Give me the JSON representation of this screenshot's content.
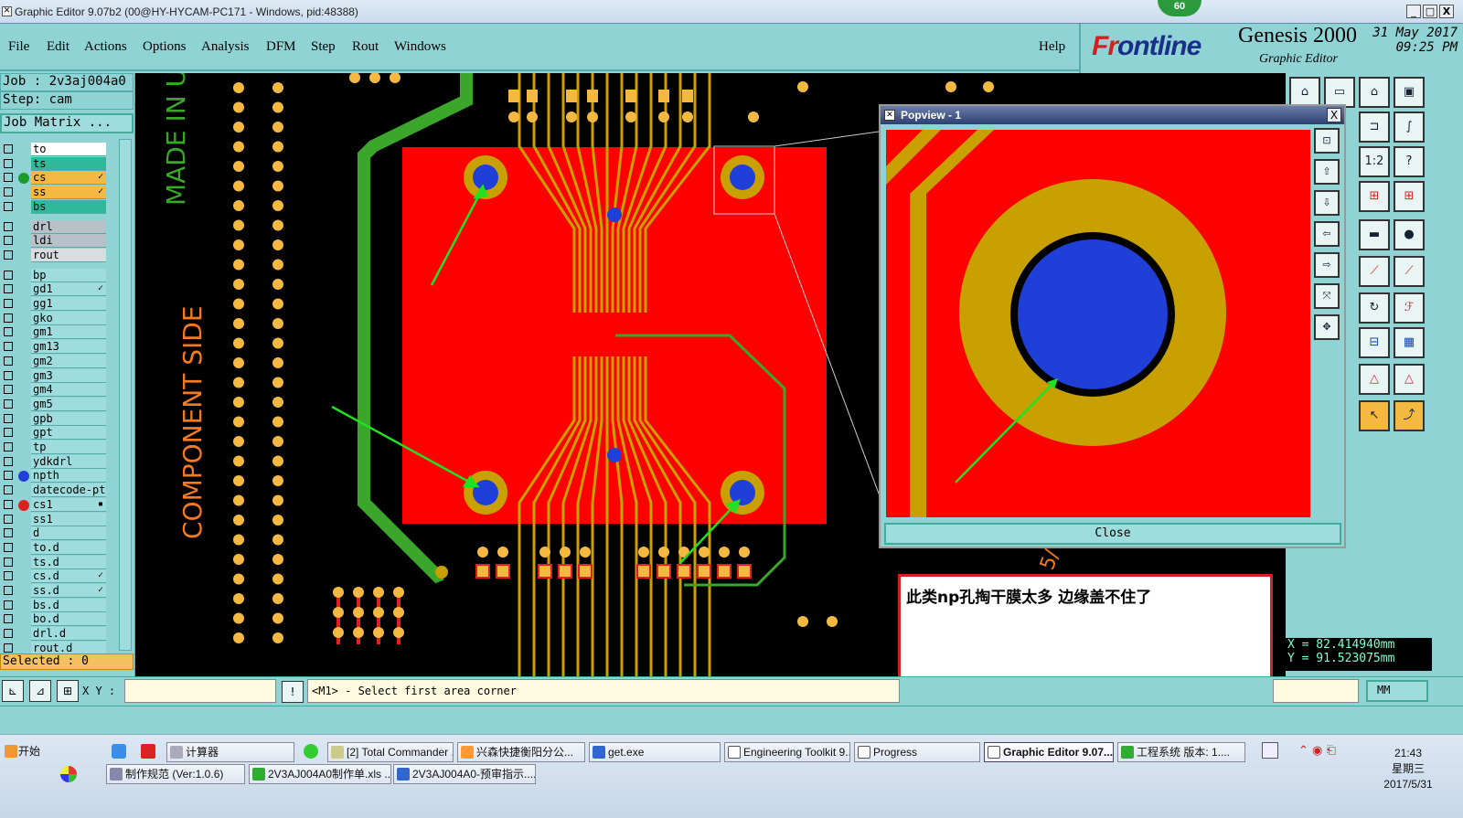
{
  "window": {
    "title": "Graphic Editor 9.07b2 (00@HY-HYCAM-PC171 - Windows, pid:48388)",
    "badge": "60",
    "min": "_",
    "max": "□",
    "close": "X"
  },
  "menu": [
    "File",
    "Edit",
    "Actions",
    "Options",
    "Analysis",
    "DFM",
    "Step",
    "Rout",
    "Windows"
  ],
  "help": "Help",
  "brand": {
    "logo_a": "Fr",
    "logo_b": "ontline",
    "product": "Genesis 2000",
    "subtitle": "Graphic Editor",
    "date": "31 May 2017",
    "time": "09:25 PM"
  },
  "job": {
    "job_line": "Job : 2v3aj004a0",
    "step_line": "Step: cam",
    "matrix": "Job Matrix ..."
  },
  "layers": [
    {
      "name": "to",
      "color": "#ffffff",
      "dot": ""
    },
    {
      "name": "ts",
      "color": "#2fb89a",
      "dot": ""
    },
    {
      "name": "cs",
      "color": "#f5b942",
      "dot": "#1e9a2a",
      "mark": "✓"
    },
    {
      "name": "ss",
      "color": "#f5b942",
      "dot": "",
      "mark": "✓"
    },
    {
      "name": "bs",
      "color": "#2fb89a",
      "dot": ""
    },
    {
      "name": "drl",
      "color": "#b8c0c8",
      "dot": ""
    },
    {
      "name": "ldi",
      "color": "#b8c0c8",
      "dot": ""
    },
    {
      "name": "rout",
      "color": "#d8dde0",
      "dot": ""
    },
    {
      "name": "bp",
      "color": "#9fdcde",
      "dot": ""
    },
    {
      "name": "gd1",
      "color": "#9fdcde",
      "dot": "",
      "mark": "✓"
    },
    {
      "name": "gg1",
      "color": "#9fdcde",
      "dot": ""
    },
    {
      "name": "gko",
      "color": "#9fdcde",
      "dot": ""
    },
    {
      "name": "gm1",
      "color": "#9fdcde",
      "dot": ""
    },
    {
      "name": "gm13",
      "color": "#9fdcde",
      "dot": ""
    },
    {
      "name": "gm2",
      "color": "#9fdcde",
      "dot": ""
    },
    {
      "name": "gm3",
      "color": "#9fdcde",
      "dot": ""
    },
    {
      "name": "gm4",
      "color": "#9fdcde",
      "dot": ""
    },
    {
      "name": "gm5",
      "color": "#9fdcde",
      "dot": ""
    },
    {
      "name": "gpb",
      "color": "#9fdcde",
      "dot": ""
    },
    {
      "name": "gpt",
      "color": "#9fdcde",
      "dot": ""
    },
    {
      "name": "tp",
      "color": "#9fdcde",
      "dot": ""
    },
    {
      "name": "ydkdrl",
      "color": "#9fdcde",
      "dot": ""
    },
    {
      "name": "npth",
      "color": "#9fdcde",
      "dot": "#1f3fd8"
    },
    {
      "name": "datecode-pt",
      "color": "#9fdcde",
      "dot": ""
    },
    {
      "name": "cs1",
      "color": "#9fdcde",
      "dot": "#e02020",
      "mark": "▪"
    },
    {
      "name": "ss1",
      "color": "#9fdcde",
      "dot": ""
    },
    {
      "name": "d",
      "color": "#9fdcde",
      "dot": ""
    },
    {
      "name": "to.d",
      "color": "#9fdcde",
      "dot": ""
    },
    {
      "name": "ts.d",
      "color": "#9fdcde",
      "dot": ""
    },
    {
      "name": "cs.d",
      "color": "#9fdcde",
      "dot": "",
      "mark": "✓"
    },
    {
      "name": "ss.d",
      "color": "#9fdcde",
      "dot": "",
      "mark": "✓"
    },
    {
      "name": "bs.d",
      "color": "#9fdcde",
      "dot": ""
    },
    {
      "name": "bo.d",
      "color": "#9fdcde",
      "dot": ""
    },
    {
      "name": "drl.d",
      "color": "#9fdcde",
      "dot": ""
    },
    {
      "name": "rout.d",
      "color": "#9fdcde",
      "dot": ""
    }
  ],
  "selected": "Selected : 0",
  "silk": {
    "made_in": "MADE IN US",
    "component_side": "COMPONENT SIDE"
  },
  "popview": {
    "title": "Popview - 1",
    "close": "Close",
    "close_x": "X"
  },
  "note": "此类np孔掏干膜太多 边缘盖不住了",
  "coords": {
    "x": "X = 82.414940mm",
    "y": "Y = 91.523075mm"
  },
  "cmd": {
    "xy_label": "X Y :",
    "xy_value": "",
    "message": "<M1> - Select first area corner",
    "unit": "MM",
    "info_btn": "!"
  },
  "right_tools": [
    "1:2",
    "?"
  ],
  "taskbar": {
    "start": "开始",
    "row1": [
      "计算器",
      "[2] Total Commander ...",
      "兴森快捷衡阳分公...",
      "get.exe",
      "Engineering Toolkit 9....",
      "Progress",
      "Graphic Editor 9.07...",
      "工程系统  版本: 1...."
    ],
    "row2": [
      "制作规范 (Ver:1.0.6)",
      "2V3AJ004A0制作单.xls ...",
      "2V3AJ004A0-预审指示...."
    ],
    "time": "21:43",
    "weekday": "星期三",
    "date": "2017/5/31"
  },
  "colors": {
    "copper": "#ff0000",
    "pad": "#c8a000",
    "drill": "#1f3fd8",
    "trace": "#3aa62a",
    "annotation_arrow": "#22e022"
  }
}
